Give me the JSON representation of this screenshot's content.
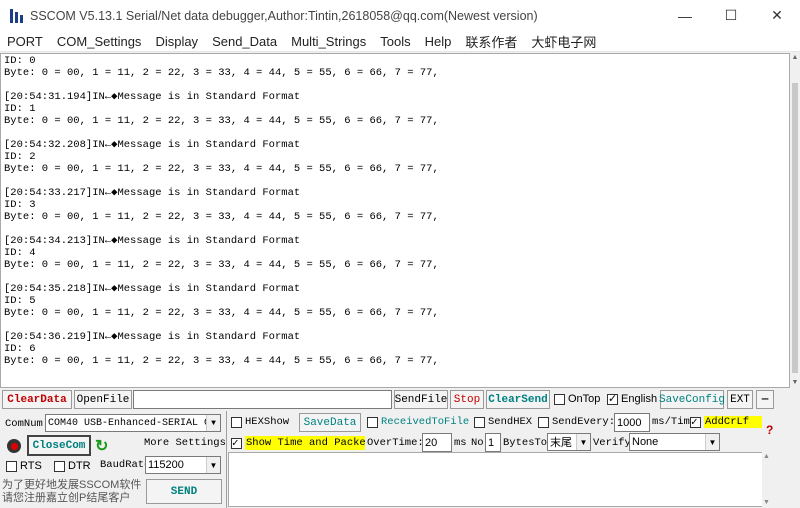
{
  "window": {
    "title": "SSCOM V5.13.1 Serial/Net data debugger,Author:Tintin,2618058@qq.com(Newest version)",
    "minimize": "—",
    "maximize": "☐",
    "close": "✕"
  },
  "menu": [
    "PORT",
    "COM_Settings",
    "Display",
    "Send_Data",
    "Multi_Strings",
    "Tools",
    "Help",
    "联系作者",
    "大虾电子网"
  ],
  "output": {
    "lines": [
      "ID: 0",
      "Byte: 0 = 00, 1 = 11, 2 = 22, 3 = 33, 4 = 44, 5 = 55, 6 = 66, 7 = 77,",
      "",
      "[20:54:31.194]IN←◆Message is in Standard Format",
      "ID: 1",
      "Byte: 0 = 00, 1 = 11, 2 = 22, 3 = 33, 4 = 44, 5 = 55, 6 = 66, 7 = 77,",
      "",
      "[20:54:32.208]IN←◆Message is in Standard Format",
      "ID: 2",
      "Byte: 0 = 00, 1 = 11, 2 = 22, 3 = 33, 4 = 44, 5 = 55, 6 = 66, 7 = 77,",
      "",
      "[20:54:33.217]IN←◆Message is in Standard Format",
      "ID: 3",
      "Byte: 0 = 00, 1 = 11, 2 = 22, 3 = 33, 4 = 44, 5 = 55, 6 = 66, 7 = 77,",
      "",
      "[20:54:34.213]IN←◆Message is in Standard Format",
      "ID: 4",
      "Byte: 0 = 00, 1 = 11, 2 = 22, 3 = 33, 4 = 44, 5 = 55, 6 = 66, 7 = 77,",
      "",
      "[20:54:35.218]IN←◆Message is in Standard Format",
      "ID: 5",
      "Byte: 0 = 00, 1 = 11, 2 = 22, 3 = 33, 4 = 44, 5 = 55, 6 = 66, 7 = 77,",
      "",
      "[20:54:36.219]IN←◆Message is in Standard Format",
      "ID: 6",
      "Byte: 0 = 00, 1 = 11, 2 = 22, 3 = 33, 4 = 44, 5 = 55, 6 = 66, 7 = 77,"
    ]
  },
  "toolbar": {
    "clear_data": "ClearData",
    "open_file": "OpenFile",
    "file_path": "",
    "send_file": "SendFile",
    "stop": "Stop",
    "clear_send": "ClearSend",
    "on_top": "OnTop",
    "english": "English",
    "save_config": "SaveConfig",
    "ext": "EXT",
    "collapse": "—"
  },
  "port": {
    "com_num_label": "ComNum",
    "com_num_value": "COM40 USB-Enhanced-SERIAL C",
    "close_com": "CloseCom",
    "more_settings": "More Settings",
    "rts": "RTS",
    "dtr": "DTR",
    "baud_label": "BaudRate:",
    "baud_value": "115200",
    "promo_line1": "为了更好地发展SSCOM软件",
    "promo_line2": "请您注册嘉立创P结尾客户",
    "send": "SEND"
  },
  "options": {
    "hex_show": "HEXShow",
    "save_data": "SaveData",
    "received_to_file": "ReceivedToFile",
    "send_hex": "SendHEX",
    "send_every": "SendEvery:",
    "send_every_value": "1000",
    "ms_per_time": "ms/Tim",
    "add_crlf": "AddCrLf",
    "question": "?",
    "show_time": "Show Time and Packe",
    "overtime_label": "OverTime:",
    "overtime_value": "20",
    "ms": "ms",
    "no_label": "No",
    "no_value": "1",
    "bytes_to": "BytesTo",
    "bytes_to_value": "末尾",
    "verify": "Verify",
    "verify_value": "None"
  },
  "checkstates": {
    "on_top": false,
    "english": true,
    "hex_show": false,
    "received_to_file": false,
    "send_hex": false,
    "send_every": false,
    "add_crlf": true,
    "show_time": true,
    "rts": false,
    "dtr": false
  }
}
